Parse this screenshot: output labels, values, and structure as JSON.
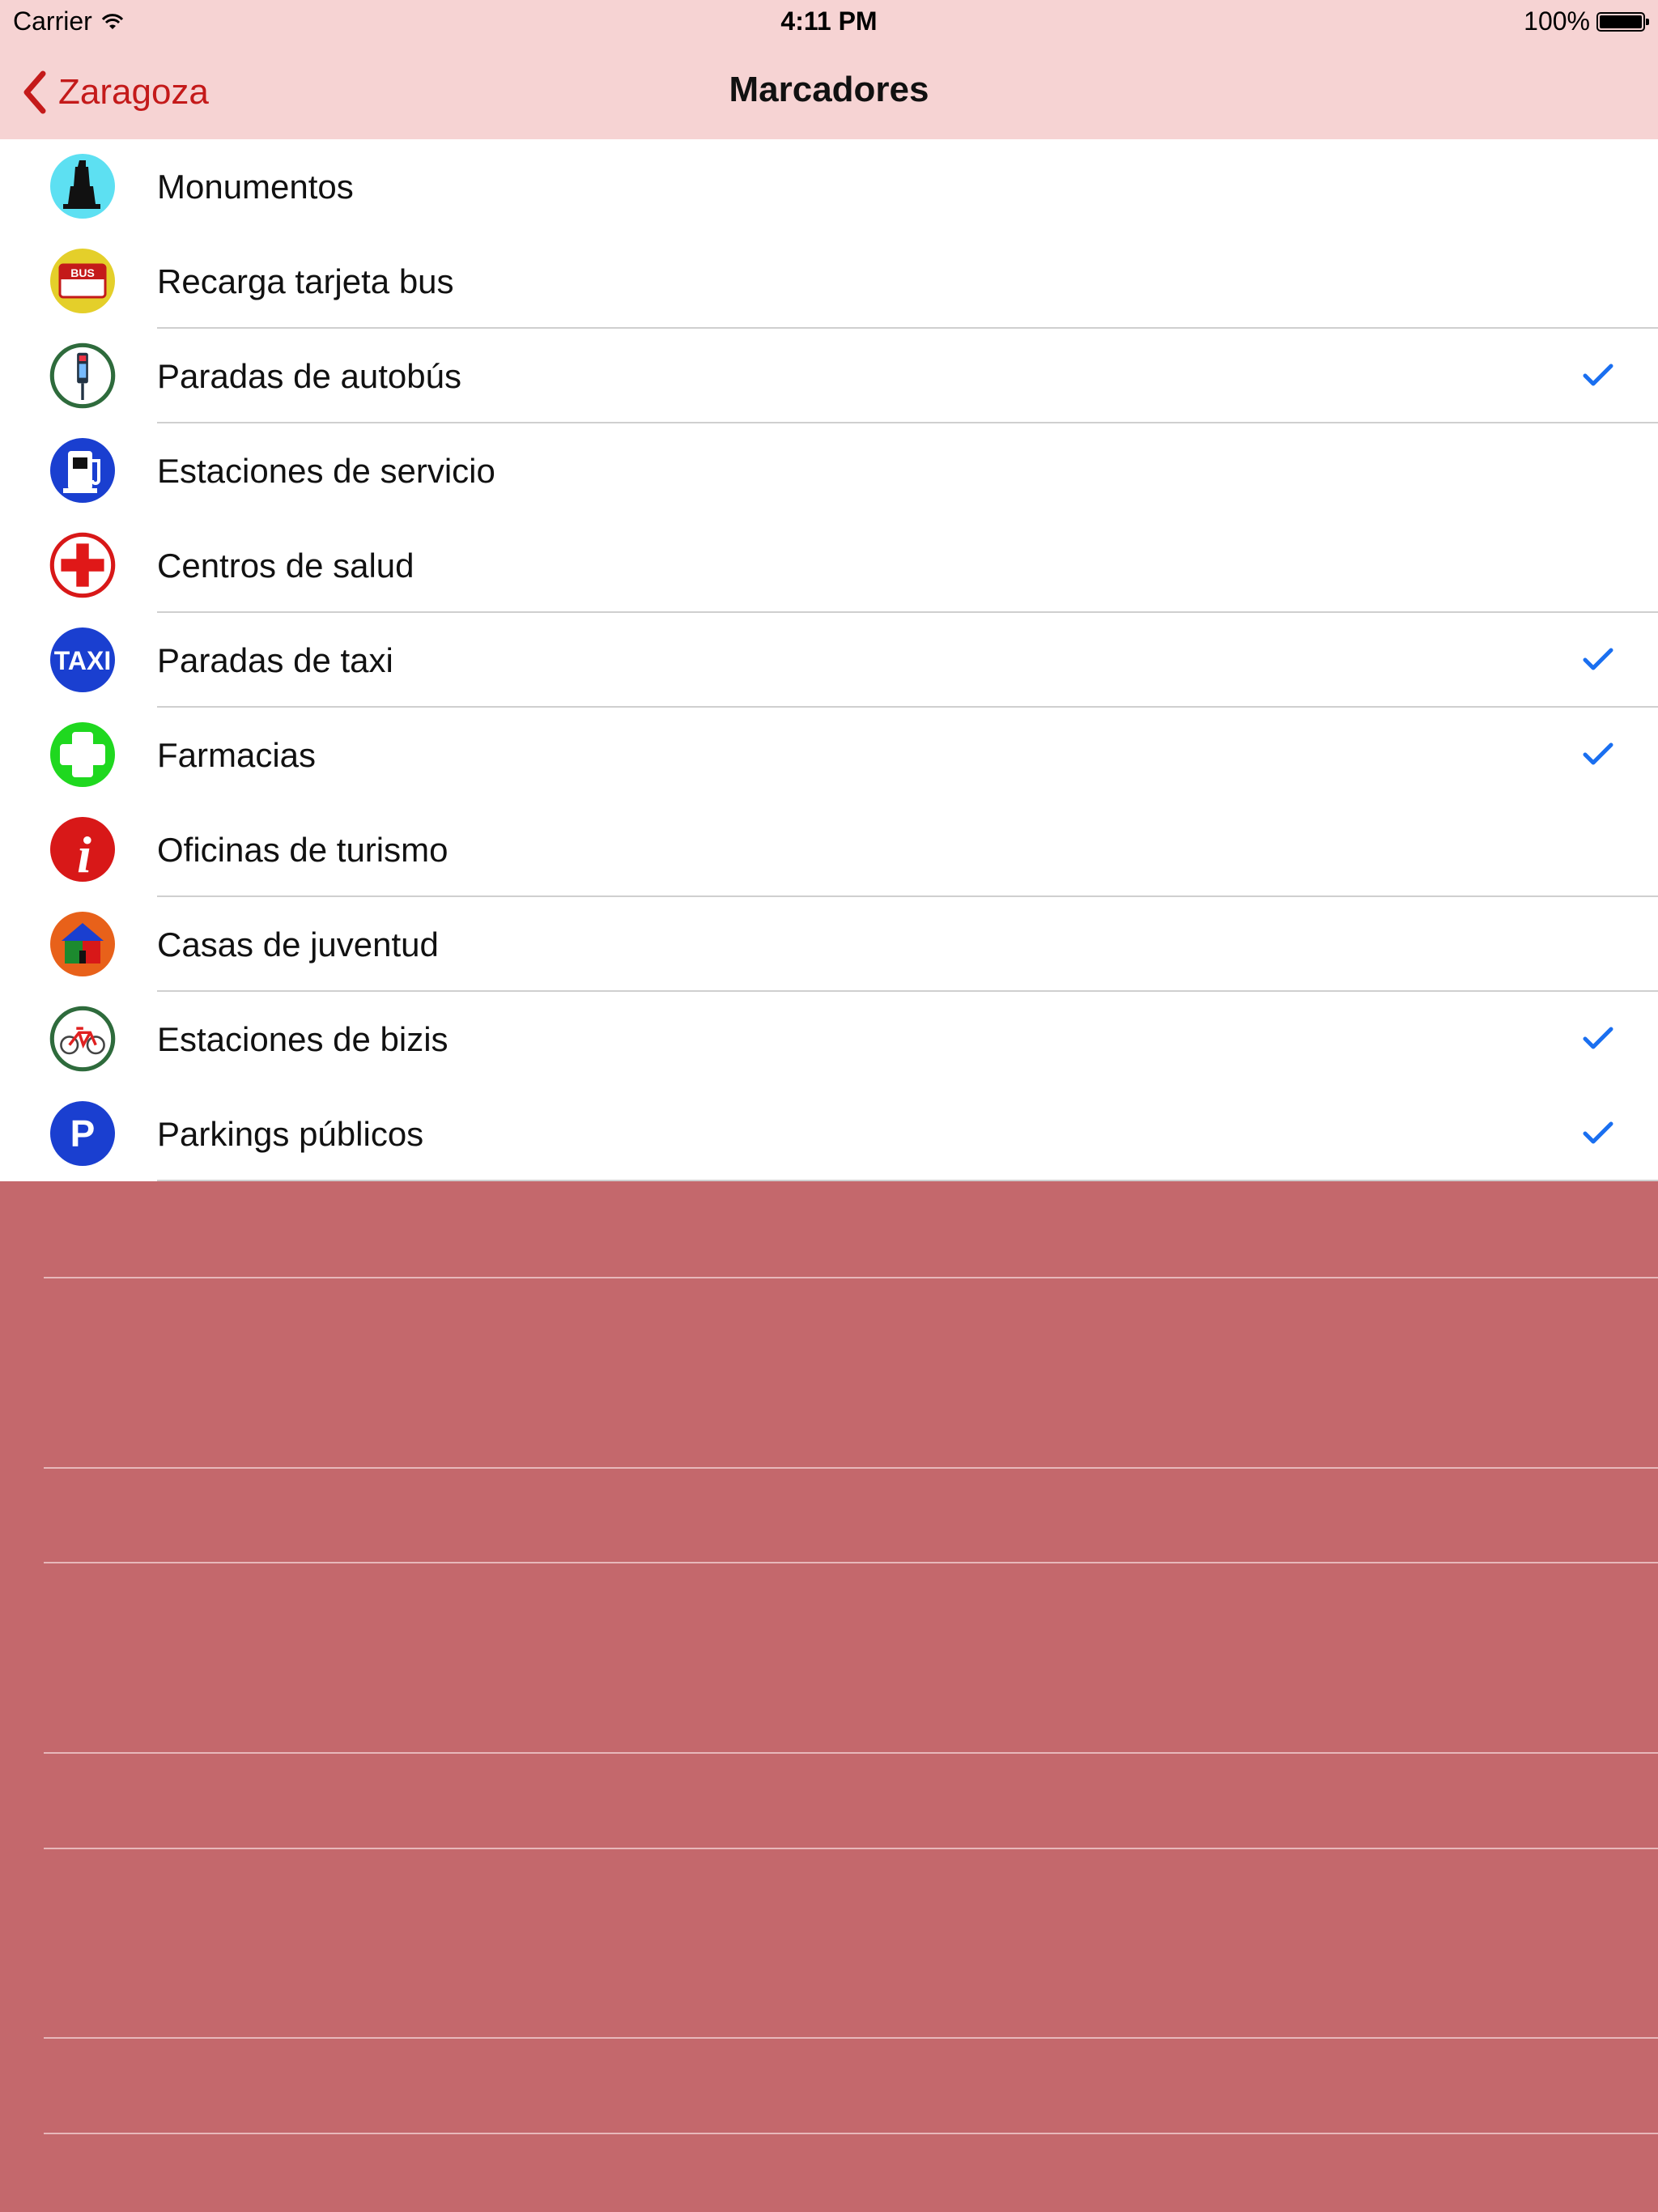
{
  "status_bar": {
    "carrier": "Carrier",
    "time": "4:11 PM",
    "battery": "100%"
  },
  "nav": {
    "back_label": "Zaragoza",
    "title": "Marcadores"
  },
  "colors": {
    "bar_bg": "#f6d3d3",
    "accent": "#c41a1a",
    "empty_bg": "#c4686c",
    "check": "#1a6ff0"
  },
  "markers": [
    {
      "label": "Monumentos",
      "icon": "monument-icon",
      "checked": false
    },
    {
      "label": "Recarga tarjeta bus",
      "icon": "bus-card-icon",
      "checked": false
    },
    {
      "label": "Paradas de autobús",
      "icon": "bus-stop-icon",
      "checked": true
    },
    {
      "label": "Estaciones de servicio",
      "icon": "gas-station-icon",
      "checked": false
    },
    {
      "label": "Centros de salud",
      "icon": "health-center-icon",
      "checked": false
    },
    {
      "label": "Paradas de taxi",
      "icon": "taxi-icon",
      "checked": true
    },
    {
      "label": "Farmacias",
      "icon": "pharmacy-icon",
      "checked": true
    },
    {
      "label": "Oficinas de turismo",
      "icon": "tourism-info-icon",
      "checked": false
    },
    {
      "label": "Casas de juventud",
      "icon": "youth-house-icon",
      "checked": false
    },
    {
      "label": "Estaciones de bizis",
      "icon": "bike-station-icon",
      "checked": true
    },
    {
      "label": "Parkings públicos",
      "icon": "parking-icon",
      "checked": true
    }
  ]
}
